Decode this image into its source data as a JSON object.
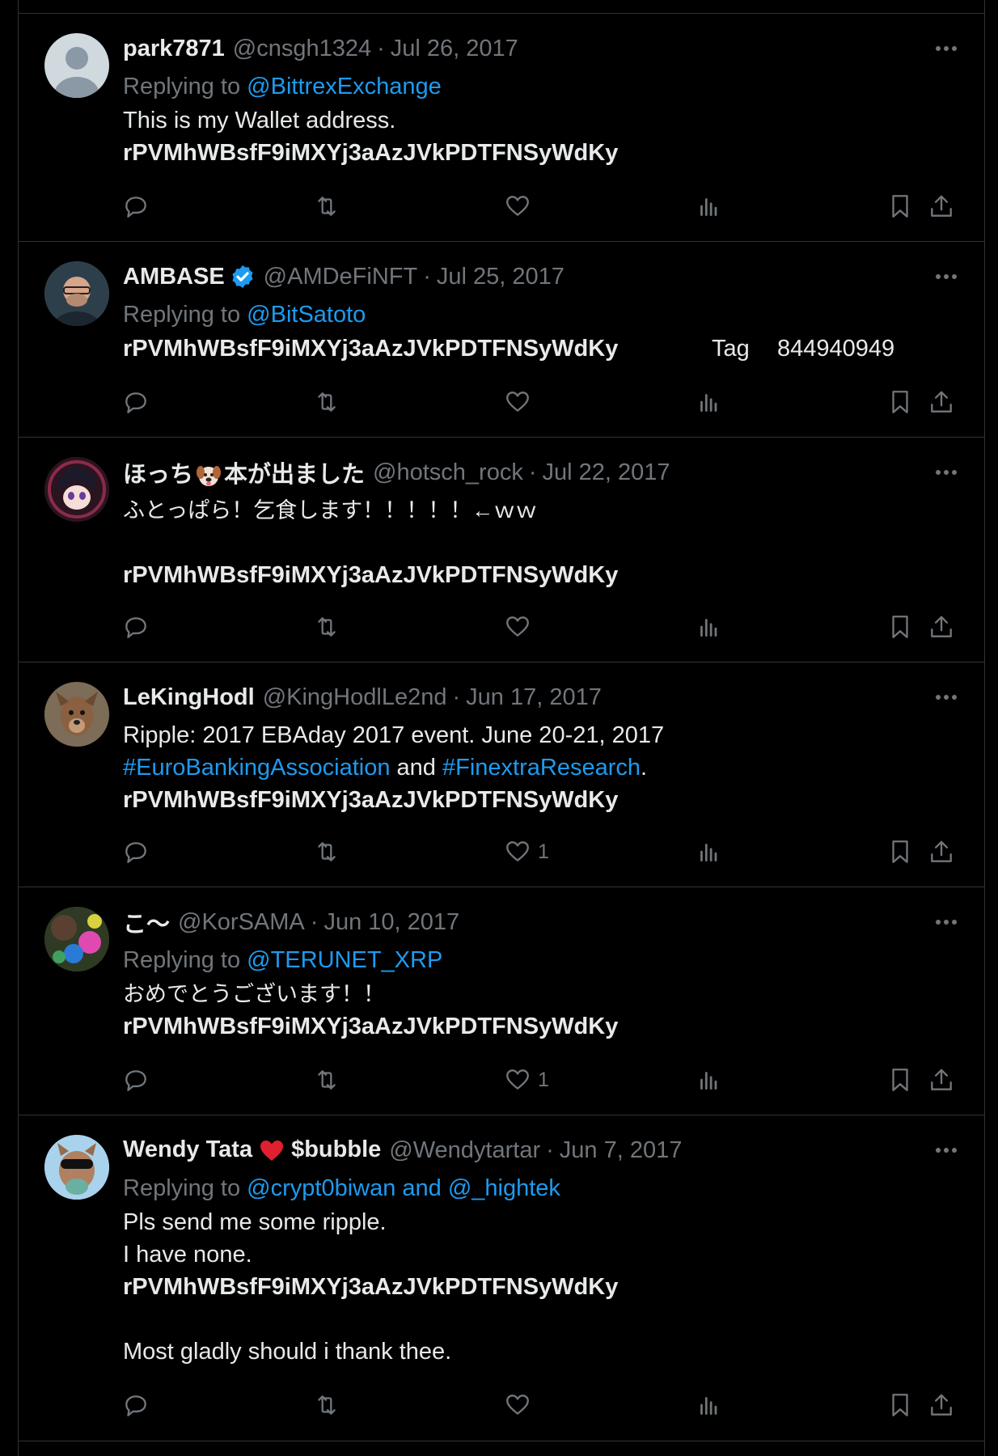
{
  "tweets": [
    {
      "name": "park7871",
      "handle": "@cnsgh1324",
      "sep": "·",
      "date": "Jul 26, 2017",
      "replying_prefix": "Replying to ",
      "replying_to": "@BittrexExchange",
      "text1": "This is my Wallet address.",
      "address": "rPVMhWBsfF9iMXYj3aAzJVkPDTFNSyWdKy"
    },
    {
      "name": "AMBASE",
      "handle": "@AMDeFiNFT",
      "sep": "·",
      "date": "Jul 25, 2017",
      "replying_prefix": "Replying to ",
      "replying_to": "@BitSatoto",
      "address": "rPVMhWBsfF9iMXYj3aAzJVkPDTFNSyWdKy",
      "tag_label": "Tag",
      "tag_value": "844940949"
    },
    {
      "name_a": "ほっち",
      "name_b": "本が出ました",
      "handle": "@hotsch_rock",
      "sep": "·",
      "date": "Jul 22, 2017",
      "text1": "ふとっぱら！乞食します！！！！！←ｗｗ",
      "address": "rPVMhWBsfF9iMXYj3aAzJVkPDTFNSyWdKy"
    },
    {
      "name": "LeKingHodl",
      "handle": "@KingHodlLe2nd",
      "sep": "·",
      "date": "Jun 17, 2017",
      "text1": "Ripple: 2017 EBAday 2017 event. June 20-21, 2017",
      "hashtag1": "#EuroBankingAssociation",
      "and": " and ",
      "hashtag2": "#FinextraResearch",
      "period": ".",
      "address": "rPVMhWBsfF9iMXYj3aAzJVkPDTFNSyWdKy",
      "likes": "1"
    },
    {
      "name": "こ〜",
      "handle": "@KorSAMA",
      "sep": "·",
      "date": "Jun 10, 2017",
      "replying_prefix": "Replying to ",
      "replying_to": "@TERUNET_XRP",
      "text1": "おめでとうございます！！",
      "address": "rPVMhWBsfF9iMXYj3aAzJVkPDTFNSyWdKy",
      "likes": "1"
    },
    {
      "name_a": "Wendy Tata",
      "name_b": "$bubble",
      "handle": "@Wendytartar",
      "sep": "·",
      "date": "Jun 7, 2017",
      "replying_prefix": "Replying to ",
      "replying_to": "@crypt0biwan and @_hightek",
      "text1": "Pls send me some ripple.",
      "text2": "I have none.",
      "address": "rPVMhWBsfF9iMXYj3aAzJVkPDTFNSyWdKy",
      "text3": "Most gladly should i thank thee."
    }
  ],
  "icons": [
    "reply-icon",
    "retweet-icon",
    "like-icon",
    "views-icon",
    "bookmark-icon",
    "share-icon",
    "more-icon",
    "verified-icon"
  ],
  "colors": {
    "background": "#000000",
    "text": "#e7e9ea",
    "muted": "#71767b",
    "link": "#1d9bf0",
    "border": "#2f3336",
    "heart": "#f91880"
  }
}
